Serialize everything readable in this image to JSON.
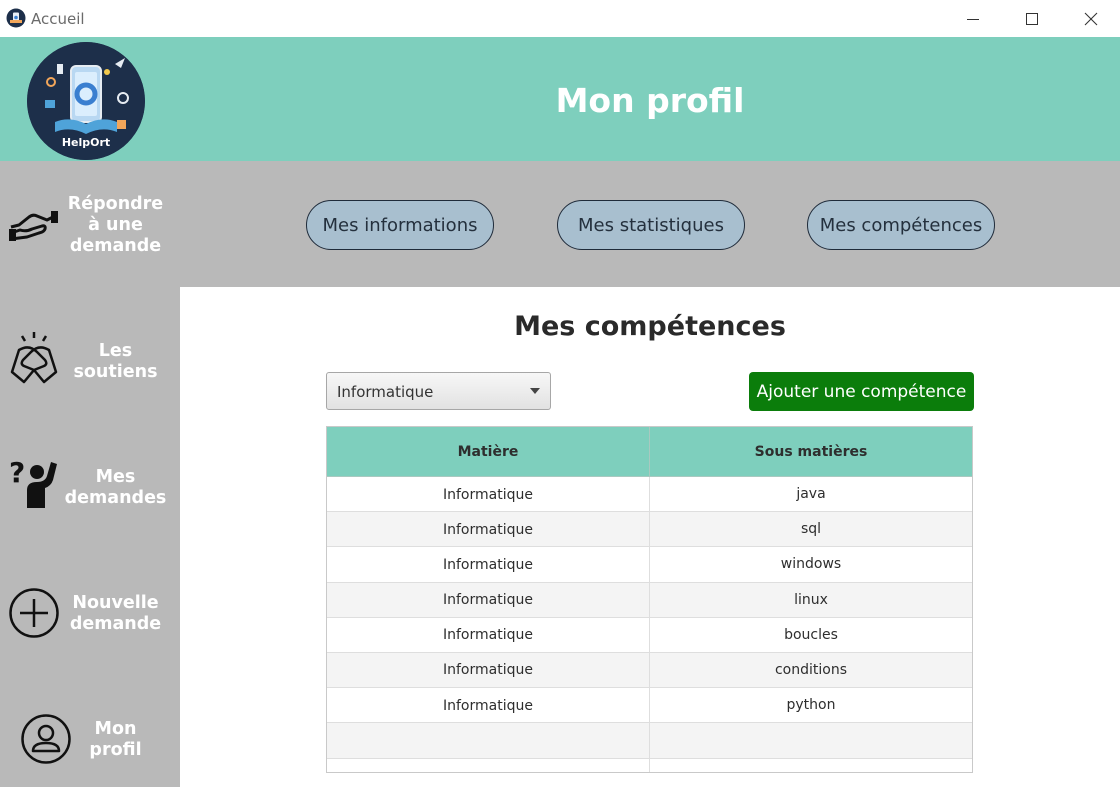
{
  "window": {
    "title": "Accueil",
    "icon": "app-icon"
  },
  "header": {
    "title": "Mon profil",
    "logo_text": "HelpOrt"
  },
  "sidebar": {
    "items": [
      {
        "label_line1": "Répondre",
        "label_line2": "à une",
        "label_line3": "demande",
        "icon": "handshake-icon"
      },
      {
        "label_line1": "Les",
        "label_line2": "soutiens",
        "icon": "support-hands-icon"
      },
      {
        "label_line1": "Mes",
        "label_line2": "demandes",
        "icon": "question-person-icon"
      },
      {
        "label_line1": "Nouvelle",
        "label_line2": "demande",
        "icon": "plus-circle-icon"
      },
      {
        "label_line1": "Mon",
        "label_line2": "profil",
        "icon": "user-circle-icon"
      }
    ]
  },
  "tabs": {
    "informations": "Mes informations",
    "statistiques": "Mes statistiques",
    "competences": "Mes compétences"
  },
  "main": {
    "title": "Mes compétences",
    "select": {
      "value": "Informatique"
    },
    "add_button": "Ajouter une compétence",
    "table": {
      "headers": [
        "Matière",
        "Sous matières"
      ],
      "rows": [
        [
          "Informatique",
          "java"
        ],
        [
          "Informatique",
          "sql"
        ],
        [
          "Informatique",
          "windows"
        ],
        [
          "Informatique",
          "linux"
        ],
        [
          "Informatique",
          "boucles"
        ],
        [
          "Informatique",
          "conditions"
        ],
        [
          "Informatique",
          "python"
        ],
        [
          "",
          ""
        ],
        [
          "",
          ""
        ]
      ]
    }
  },
  "colors": {
    "header_bg": "#7ecfbd",
    "sidebar_bg": "#b9b9b9",
    "tab_bg": "#a8bfcf",
    "add_button_bg": "#0b7d0b"
  }
}
